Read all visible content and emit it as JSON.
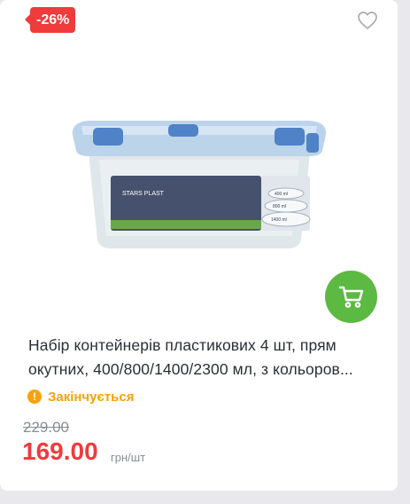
{
  "product": {
    "discount_badge": "-26%",
    "title_line1": "Набір контейнерів пластикових 4 шт, прям",
    "title_line2": "окутних, 400/800/1400/2300 мл, з кольоров...",
    "stock_status": "Закінчується",
    "old_price": "229.00",
    "price": "169.00",
    "unit": "грн/шт",
    "image": {
      "box_brand_text": "STARS PLAST",
      "box_size_labels": [
        "400 ml",
        "800 ml",
        "1400 ml"
      ]
    }
  },
  "icons": {
    "favorite": "heart-outline-icon",
    "cart": "cart-icon",
    "stock_warning": "exclamation-icon"
  },
  "colors": {
    "discount": "#ef3b3b",
    "cart_button": "#5cb942",
    "warning": "#f5a20a",
    "price": "#ef3b3b"
  }
}
